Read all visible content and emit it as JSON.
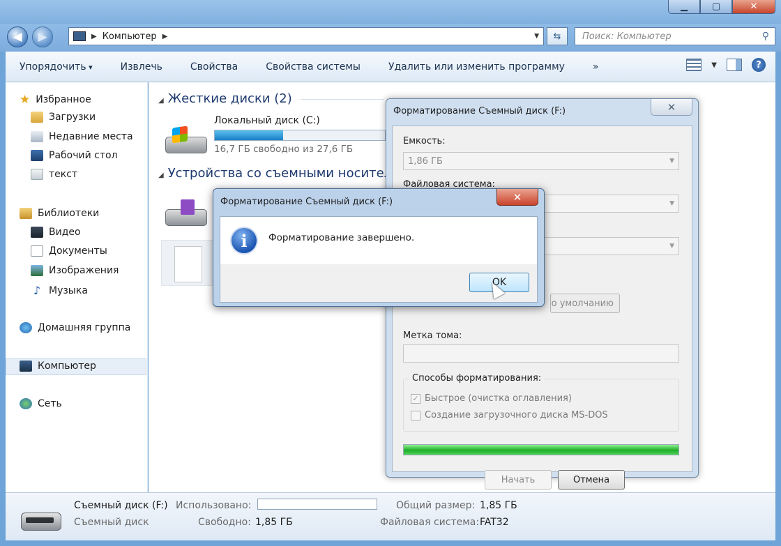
{
  "window": {
    "min": "▁",
    "max": "▢",
    "close": "✕"
  },
  "nav": {
    "address": "Компьютер",
    "search_placeholder": "Поиск: Компьютер"
  },
  "toolbar": {
    "organize": "Упорядочить",
    "eject": "Извлечь",
    "properties": "Свойства",
    "system_properties": "Свойства системы",
    "uninstall": "Удалить или изменить программу",
    "more": "»"
  },
  "sidebar": {
    "favorites": "Избранное",
    "downloads": "Загрузки",
    "recent": "Недавние места",
    "desktop": "Рабочий стол",
    "text": "текст",
    "libraries": "Библиотеки",
    "video": "Видео",
    "documents": "Документы",
    "images": "Изображения",
    "music": "Музыка",
    "homegroup": "Домашняя группа",
    "computer": "Компьютер",
    "network": "Сеть"
  },
  "main": {
    "hdd_group": "Жесткие диски (2)",
    "removable_group": "Устройства со съемными носител",
    "drive_c": {
      "name": "Локальный диск (C:)",
      "free": "16,7 ГБ свободно из 27,6 ГБ",
      "used_fraction": 0.4
    }
  },
  "status": {
    "drive_name": "Съемный диск (F:)",
    "drive_type": "Съемный диск",
    "used_label": "Использовано:",
    "free_label": "Свободно:",
    "free_value": "1,85 ГБ",
    "total_label": "Общий размер:",
    "total_value": "1,85 ГБ",
    "fs_label": "Файловая система:",
    "fs_value": "FAT32"
  },
  "format_dialog": {
    "title": "Форматирование Съемный диск (F:)",
    "capacity_label": "Емкость:",
    "capacity_value": "1,86 ГБ",
    "fs_label": "Файловая система:",
    "defaults_button": "о умолчанию",
    "volume_label": "Метка тома:",
    "options_title": "Способы форматирования:",
    "quick": "Быстрое (очистка оглавления)",
    "msdos": "Создание загрузочного диска MS-DOS",
    "progress_fraction": 1.0,
    "start": "Начать",
    "cancel": "Отмена"
  },
  "message": {
    "title": "Форматирование Съемный диск (F:)",
    "text": "Форматирование завершено.",
    "ok": "OK"
  }
}
